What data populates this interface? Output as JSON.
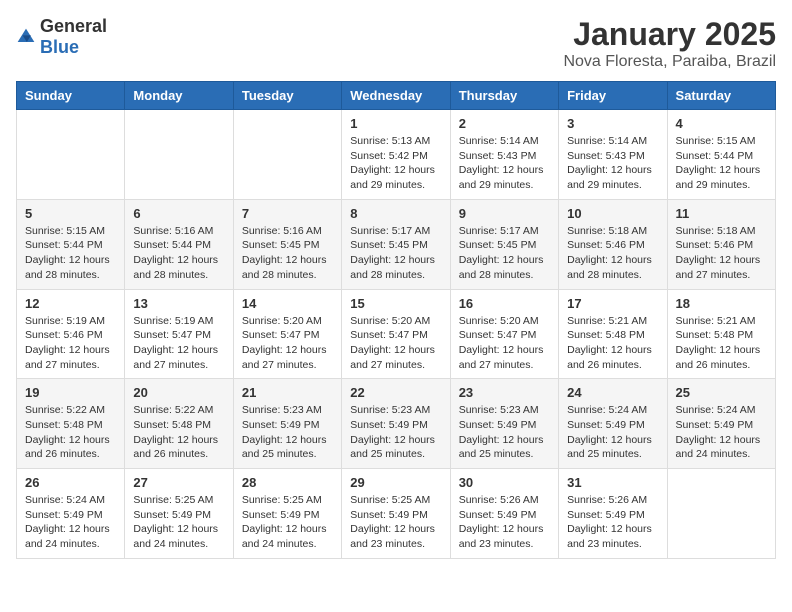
{
  "logo": {
    "general": "General",
    "blue": "Blue"
  },
  "title": "January 2025",
  "location": "Nova Floresta, Paraiba, Brazil",
  "weekdays": [
    "Sunday",
    "Monday",
    "Tuesday",
    "Wednesday",
    "Thursday",
    "Friday",
    "Saturday"
  ],
  "weeks": [
    [
      {
        "day": "",
        "sunrise": "",
        "sunset": "",
        "daylight": ""
      },
      {
        "day": "",
        "sunrise": "",
        "sunset": "",
        "daylight": ""
      },
      {
        "day": "",
        "sunrise": "",
        "sunset": "",
        "daylight": ""
      },
      {
        "day": "1",
        "sunrise": "Sunrise: 5:13 AM",
        "sunset": "Sunset: 5:42 PM",
        "daylight": "Daylight: 12 hours and 29 minutes."
      },
      {
        "day": "2",
        "sunrise": "Sunrise: 5:14 AM",
        "sunset": "Sunset: 5:43 PM",
        "daylight": "Daylight: 12 hours and 29 minutes."
      },
      {
        "day": "3",
        "sunrise": "Sunrise: 5:14 AM",
        "sunset": "Sunset: 5:43 PM",
        "daylight": "Daylight: 12 hours and 29 minutes."
      },
      {
        "day": "4",
        "sunrise": "Sunrise: 5:15 AM",
        "sunset": "Sunset: 5:44 PM",
        "daylight": "Daylight: 12 hours and 29 minutes."
      }
    ],
    [
      {
        "day": "5",
        "sunrise": "Sunrise: 5:15 AM",
        "sunset": "Sunset: 5:44 PM",
        "daylight": "Daylight: 12 hours and 28 minutes."
      },
      {
        "day": "6",
        "sunrise": "Sunrise: 5:16 AM",
        "sunset": "Sunset: 5:44 PM",
        "daylight": "Daylight: 12 hours and 28 minutes."
      },
      {
        "day": "7",
        "sunrise": "Sunrise: 5:16 AM",
        "sunset": "Sunset: 5:45 PM",
        "daylight": "Daylight: 12 hours and 28 minutes."
      },
      {
        "day": "8",
        "sunrise": "Sunrise: 5:17 AM",
        "sunset": "Sunset: 5:45 PM",
        "daylight": "Daylight: 12 hours and 28 minutes."
      },
      {
        "day": "9",
        "sunrise": "Sunrise: 5:17 AM",
        "sunset": "Sunset: 5:45 PM",
        "daylight": "Daylight: 12 hours and 28 minutes."
      },
      {
        "day": "10",
        "sunrise": "Sunrise: 5:18 AM",
        "sunset": "Sunset: 5:46 PM",
        "daylight": "Daylight: 12 hours and 28 minutes."
      },
      {
        "day": "11",
        "sunrise": "Sunrise: 5:18 AM",
        "sunset": "Sunset: 5:46 PM",
        "daylight": "Daylight: 12 hours and 27 minutes."
      }
    ],
    [
      {
        "day": "12",
        "sunrise": "Sunrise: 5:19 AM",
        "sunset": "Sunset: 5:46 PM",
        "daylight": "Daylight: 12 hours and 27 minutes."
      },
      {
        "day": "13",
        "sunrise": "Sunrise: 5:19 AM",
        "sunset": "Sunset: 5:47 PM",
        "daylight": "Daylight: 12 hours and 27 minutes."
      },
      {
        "day": "14",
        "sunrise": "Sunrise: 5:20 AM",
        "sunset": "Sunset: 5:47 PM",
        "daylight": "Daylight: 12 hours and 27 minutes."
      },
      {
        "day": "15",
        "sunrise": "Sunrise: 5:20 AM",
        "sunset": "Sunset: 5:47 PM",
        "daylight": "Daylight: 12 hours and 27 minutes."
      },
      {
        "day": "16",
        "sunrise": "Sunrise: 5:20 AM",
        "sunset": "Sunset: 5:47 PM",
        "daylight": "Daylight: 12 hours and 27 minutes."
      },
      {
        "day": "17",
        "sunrise": "Sunrise: 5:21 AM",
        "sunset": "Sunset: 5:48 PM",
        "daylight": "Daylight: 12 hours and 26 minutes."
      },
      {
        "day": "18",
        "sunrise": "Sunrise: 5:21 AM",
        "sunset": "Sunset: 5:48 PM",
        "daylight": "Daylight: 12 hours and 26 minutes."
      }
    ],
    [
      {
        "day": "19",
        "sunrise": "Sunrise: 5:22 AM",
        "sunset": "Sunset: 5:48 PM",
        "daylight": "Daylight: 12 hours and 26 minutes."
      },
      {
        "day": "20",
        "sunrise": "Sunrise: 5:22 AM",
        "sunset": "Sunset: 5:48 PM",
        "daylight": "Daylight: 12 hours and 26 minutes."
      },
      {
        "day": "21",
        "sunrise": "Sunrise: 5:23 AM",
        "sunset": "Sunset: 5:49 PM",
        "daylight": "Daylight: 12 hours and 25 minutes."
      },
      {
        "day": "22",
        "sunrise": "Sunrise: 5:23 AM",
        "sunset": "Sunset: 5:49 PM",
        "daylight": "Daylight: 12 hours and 25 minutes."
      },
      {
        "day": "23",
        "sunrise": "Sunrise: 5:23 AM",
        "sunset": "Sunset: 5:49 PM",
        "daylight": "Daylight: 12 hours and 25 minutes."
      },
      {
        "day": "24",
        "sunrise": "Sunrise: 5:24 AM",
        "sunset": "Sunset: 5:49 PM",
        "daylight": "Daylight: 12 hours and 25 minutes."
      },
      {
        "day": "25",
        "sunrise": "Sunrise: 5:24 AM",
        "sunset": "Sunset: 5:49 PM",
        "daylight": "Daylight: 12 hours and 24 minutes."
      }
    ],
    [
      {
        "day": "26",
        "sunrise": "Sunrise: 5:24 AM",
        "sunset": "Sunset: 5:49 PM",
        "daylight": "Daylight: 12 hours and 24 minutes."
      },
      {
        "day": "27",
        "sunrise": "Sunrise: 5:25 AM",
        "sunset": "Sunset: 5:49 PM",
        "daylight": "Daylight: 12 hours and 24 minutes."
      },
      {
        "day": "28",
        "sunrise": "Sunrise: 5:25 AM",
        "sunset": "Sunset: 5:49 PM",
        "daylight": "Daylight: 12 hours and 24 minutes."
      },
      {
        "day": "29",
        "sunrise": "Sunrise: 5:25 AM",
        "sunset": "Sunset: 5:49 PM",
        "daylight": "Daylight: 12 hours and 23 minutes."
      },
      {
        "day": "30",
        "sunrise": "Sunrise: 5:26 AM",
        "sunset": "Sunset: 5:49 PM",
        "daylight": "Daylight: 12 hours and 23 minutes."
      },
      {
        "day": "31",
        "sunrise": "Sunrise: 5:26 AM",
        "sunset": "Sunset: 5:49 PM",
        "daylight": "Daylight: 12 hours and 23 minutes."
      },
      {
        "day": "",
        "sunrise": "",
        "sunset": "",
        "daylight": ""
      }
    ]
  ]
}
